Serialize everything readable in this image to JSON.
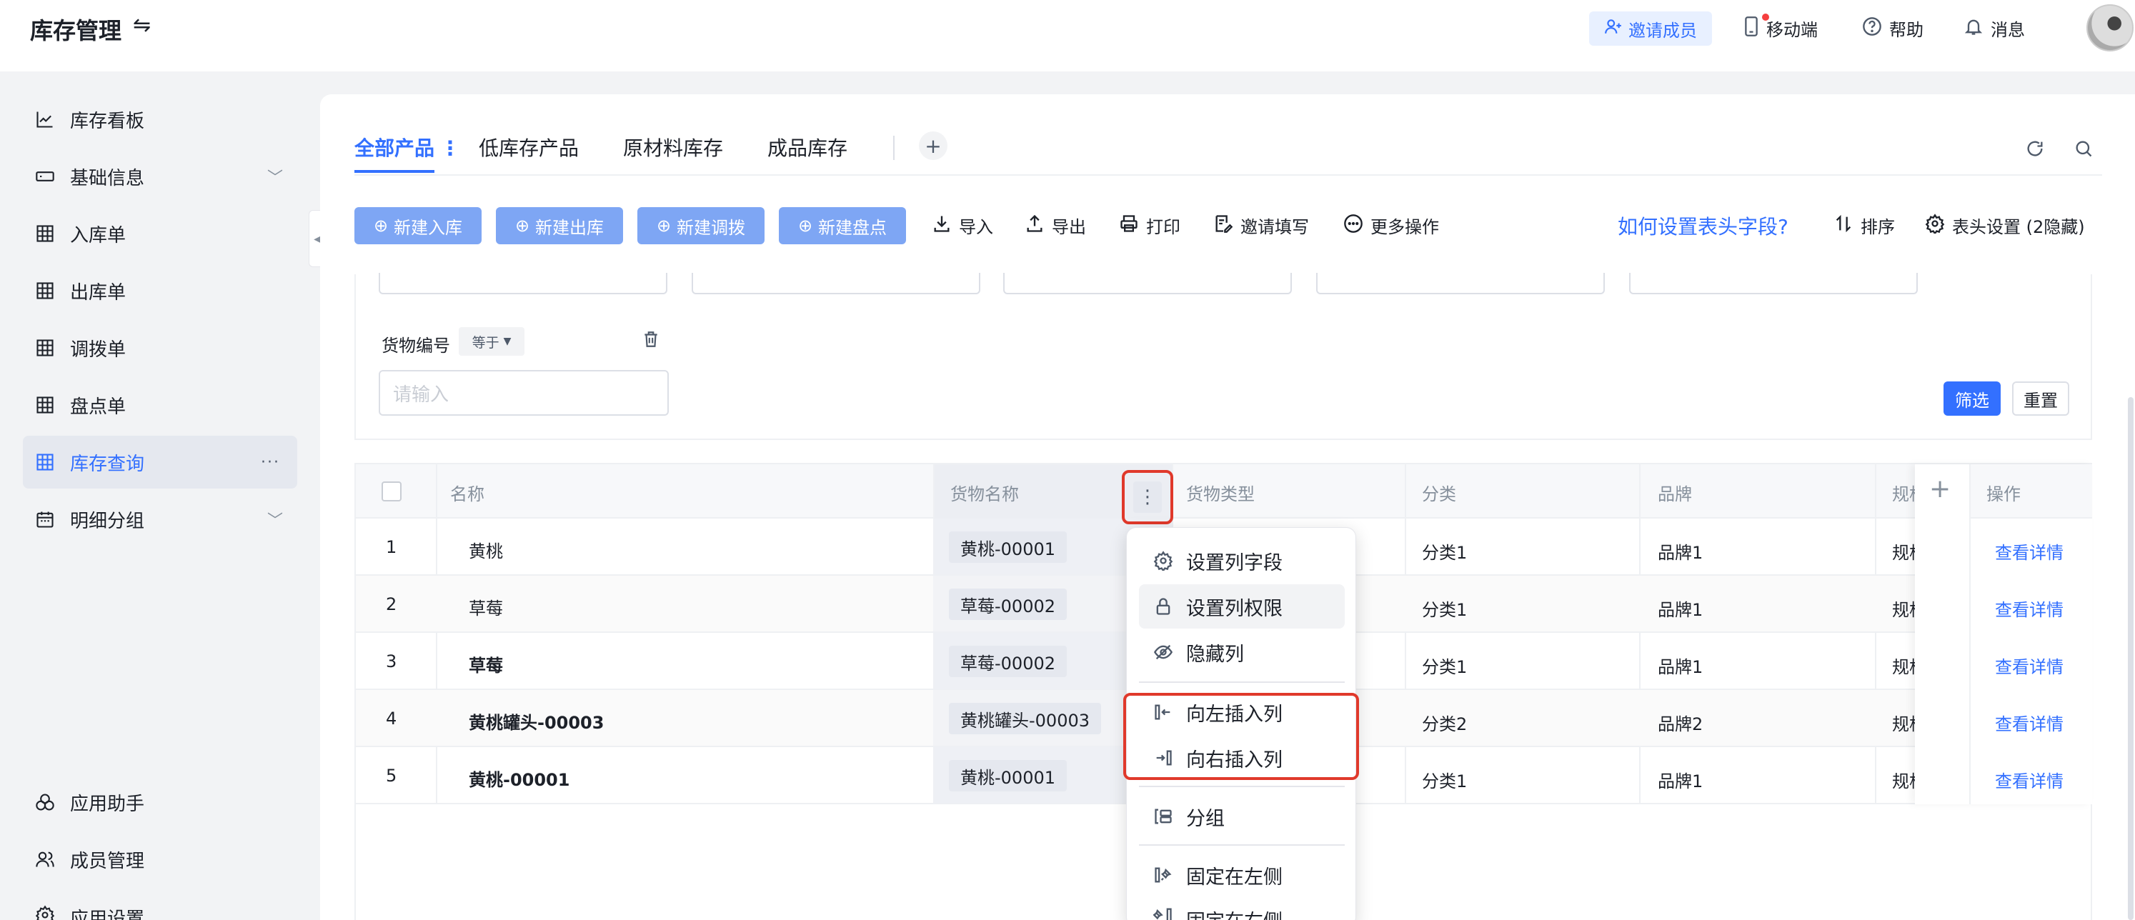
{
  "header": {
    "app_title": "库存管理",
    "invite": "邀请成员",
    "mobile": "移动端",
    "help": "帮助",
    "messages": "消息"
  },
  "sidebar": {
    "items": [
      {
        "label": "库存看板"
      },
      {
        "label": "基础信息"
      },
      {
        "label": "入库单"
      },
      {
        "label": "出库单"
      },
      {
        "label": "调拨单"
      },
      {
        "label": "盘点单"
      },
      {
        "label": "库存查询"
      },
      {
        "label": "明细分组"
      }
    ],
    "bottom": [
      {
        "label": "应用助手"
      },
      {
        "label": "成员管理"
      },
      {
        "label": "应用设置"
      }
    ]
  },
  "tabs": [
    {
      "label": "全部产品"
    },
    {
      "label": "低库存产品"
    },
    {
      "label": "原材料库存"
    },
    {
      "label": "成品库存"
    }
  ],
  "toolbar": {
    "new_in": "新建入库",
    "new_out": "新建出库",
    "new_transfer": "新建调拨",
    "new_count": "新建盘点",
    "import": "导入",
    "export": "导出",
    "print": "打印",
    "invite_fill": "邀请填写",
    "more_actions": "更多操作",
    "how_to": "如何设置表头字段?",
    "sort": "排序",
    "header_settings": "表头设置 (2隐藏)"
  },
  "filter": {
    "field_label": "货物编号",
    "operator": "等于",
    "input_placeholder": "请输入",
    "filter_btn": "筛选",
    "reset_btn": "重置"
  },
  "table": {
    "columns": [
      "名称",
      "货物名称",
      "货物类型",
      "分类",
      "品牌",
      "规格",
      "操作"
    ],
    "rows": [
      {
        "idx": "1",
        "name": "黄桃",
        "goods": "黄桃-00001",
        "category": "分类1",
        "brand": "品牌1",
        "spec": "规格",
        "action": "查看详情"
      },
      {
        "idx": "2",
        "name": "草莓",
        "goods": "草莓-00002",
        "category": "分类1",
        "brand": "品牌1",
        "spec": "规格",
        "action": "查看详情"
      },
      {
        "idx": "3",
        "name": "草莓",
        "goods": "草莓-00002",
        "category": "分类1",
        "brand": "品牌1",
        "spec": "规格",
        "action": "查看详情"
      },
      {
        "idx": "4",
        "name": "黄桃罐头-00003",
        "goods": "黄桃罐头-00003",
        "category": "分类2",
        "brand": "品牌2",
        "spec": "规格",
        "action": "查看详情"
      },
      {
        "idx": "5",
        "name": "黄桃-00001",
        "goods": "黄桃-00001",
        "category": "分类1",
        "brand": "品牌1",
        "spec": "规格",
        "action": "查看详情"
      }
    ]
  },
  "column_menu": {
    "items": [
      {
        "label": "设置列字段"
      },
      {
        "label": "设置列权限"
      },
      {
        "label": "隐藏列"
      },
      {
        "label": "向左插入列"
      },
      {
        "label": "向右插入列"
      },
      {
        "label": "分组"
      },
      {
        "label": "固定在左侧"
      },
      {
        "label": "固定在右侧"
      }
    ]
  }
}
